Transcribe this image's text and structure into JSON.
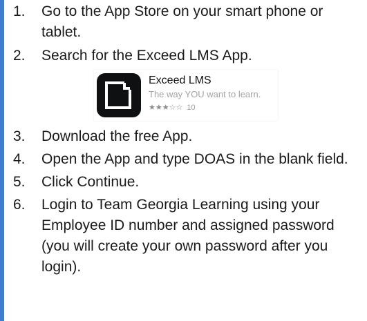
{
  "steps": [
    {
      "num": "1.",
      "text": "Go to the App Store on your smart phone or tablet."
    },
    {
      "num": "2.",
      "text": "Search for the Exceed LMS App."
    },
    {
      "num": "3.",
      "text": "Download the free App."
    },
    {
      "num": "4.",
      "text": "Open the App and type DOAS in the blank field."
    },
    {
      "num": "5.",
      "text": "Click Continue."
    },
    {
      "num": "6.",
      "text": "Login to Team Georgia Learning using your Employee ID number and assigned password (you will create your own password after you login)."
    }
  ],
  "app_card": {
    "name": "Exceed LMS",
    "tagline": "The way YOU want to learn.",
    "stars": "★★★☆☆",
    "rating_value": 3,
    "rating_max": 5,
    "review_count": "10",
    "icon": "exceed-lms-logo-icon"
  },
  "colors": {
    "accent_bar": "#3b7fd0",
    "icon_bg": "#0f1011",
    "tagline": "#a3a3a3"
  }
}
